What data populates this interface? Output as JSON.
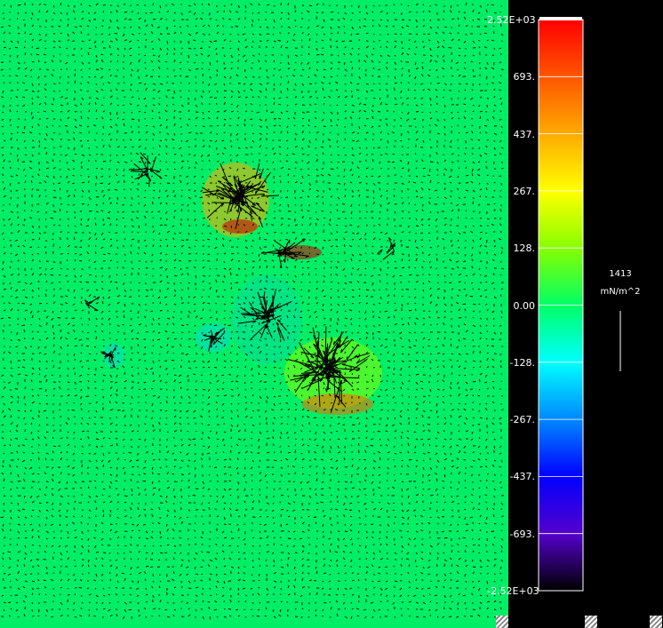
{
  "chart_data": {
    "type": "vector field over color map",
    "colorbar": {
      "ticks": [
        "2.52E+03",
        "693.",
        "437.",
        "267.",
        "128.",
        "0.00",
        "-128.",
        "-267.",
        "-437.",
        "-693.",
        "-2.52E+03"
      ],
      "colors_top_to_bottom": [
        "#ff0000",
        "#ff5500",
        "#ffaa00",
        "#ffff00",
        "#88ff00",
        "#00ff66",
        "#00ffff",
        "#0088ff",
        "#0000ff",
        "#5500cc",
        "#000000"
      ]
    },
    "scale_arrow": {
      "value": "1413",
      "unit": "mN/m^2"
    },
    "background_color": "#00ee66",
    "vector_color": "#000000"
  }
}
